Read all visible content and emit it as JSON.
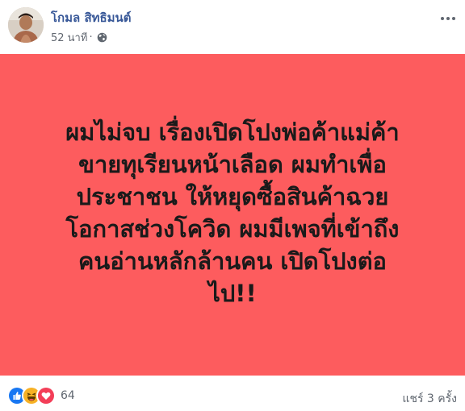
{
  "post": {
    "author_name": "โกมล สิทธิมนต์",
    "timestamp": "52 นาที",
    "dot": "·",
    "privacy_icon": "globe-icon",
    "more_icon": "more-horizontal-icon",
    "background_color": "#fd5c5e",
    "text_lines": [
      "ผมไม่จบ เรื่องเปิดโปงพ่อค้าแม่ค้า",
      "ขายทุเรียนหน้าเลือด ผมทำเพื่อ",
      "ประชาชน ให้หยุดซื้อสินค้าฉวย",
      "โอกาสช่วงโควิด ผมมีเพจที่เข้าถึง",
      "คนอ่านหลักล้านคน เปิดโปงต่อ",
      "ไป!!"
    ]
  },
  "footer": {
    "reaction_icons": [
      "like-icon",
      "haha-icon",
      "love-icon"
    ],
    "reaction_count": "64",
    "shares": "แชร์ 3 ครั้ง"
  }
}
